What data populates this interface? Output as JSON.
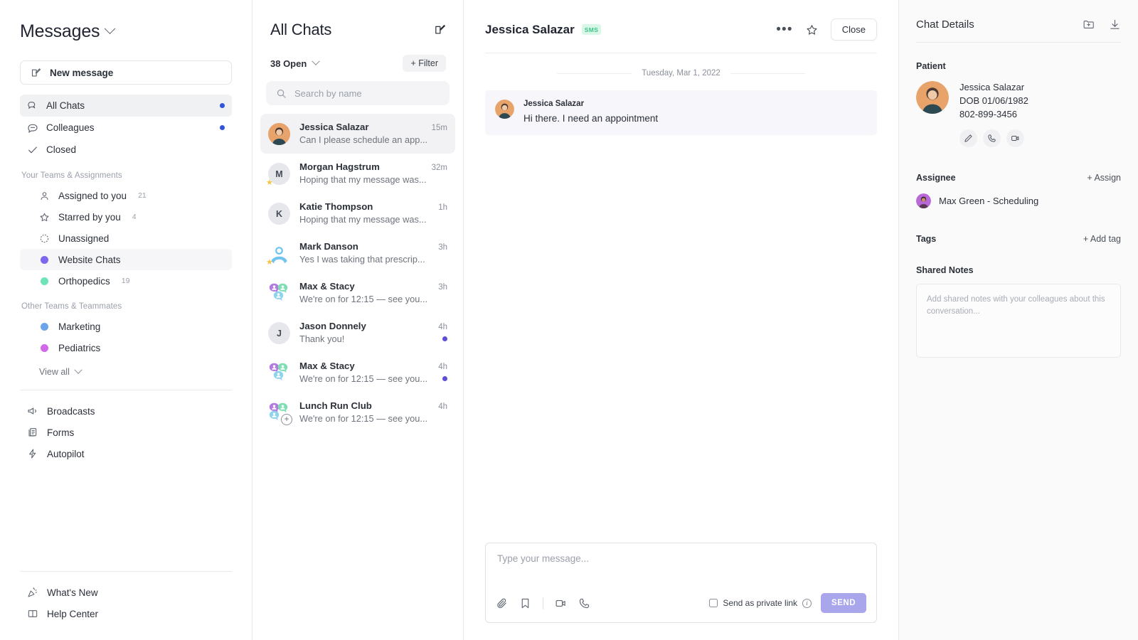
{
  "nav": {
    "title": "Messages",
    "new_message_label": "New message",
    "primary_items": [
      {
        "label": "All Chats",
        "icon": "chats-icon",
        "unread": true,
        "active": true
      },
      {
        "label": "Colleagues",
        "icon": "speech-bubble-icon",
        "unread": true,
        "active": false
      },
      {
        "label": "Closed",
        "icon": "check-icon",
        "unread": false,
        "active": false
      }
    ],
    "your_teams_label": "Your Teams & Assignments",
    "your_teams": [
      {
        "label": "Assigned to you",
        "count": "21",
        "icon": "person-icon",
        "color": ""
      },
      {
        "label": "Starred by you",
        "count": "4",
        "icon": "star-icon",
        "color": ""
      },
      {
        "label": "Unassigned",
        "count": "",
        "icon": "dashed-circle-icon",
        "color": ""
      },
      {
        "label": "Website Chats",
        "count": "",
        "icon": "color-dot",
        "color": "#7b68ee"
      },
      {
        "label": "Orthopedics",
        "count": "19",
        "icon": "color-dot",
        "color": "#6fe3b8"
      }
    ],
    "other_teams_label": "Other Teams & Teammates",
    "other_teams": [
      {
        "label": "Marketing",
        "count": "",
        "icon": "color-dot",
        "color": "#6ba4e8"
      },
      {
        "label": "Pediatrics",
        "count": "",
        "icon": "color-dot",
        "color": "#d369e8"
      }
    ],
    "view_all_label": "View all",
    "tools": [
      {
        "label": "Broadcasts",
        "icon": "megaphone-icon"
      },
      {
        "label": "Forms",
        "icon": "forms-icon"
      },
      {
        "label": "Autopilot",
        "icon": "bolt-icon"
      }
    ],
    "footer": [
      {
        "label": "What's New",
        "icon": "confetti-icon"
      },
      {
        "label": "Help Center",
        "icon": "book-icon"
      }
    ]
  },
  "list": {
    "title": "All Chats",
    "compose_icon": "compose-icon",
    "open_count_label": "38 Open",
    "filter_label": "+ Filter",
    "search_placeholder": "Search by name",
    "search_value": "",
    "chats": [
      {
        "name": "Jessica Salazar",
        "time": "15m",
        "preview": "Can I please schedule an app...",
        "avatar": "photo",
        "avatar_color": "#e8a36b",
        "initial": "",
        "starred": false,
        "unread": false,
        "active": true
      },
      {
        "name": "Morgan Hagstrum",
        "time": "32m",
        "preview": "Hoping that my message was...",
        "avatar": "initial",
        "avatar_color": "#e6e7ea",
        "initial": "M",
        "starred": true,
        "unread": false,
        "active": false
      },
      {
        "name": "Katie Thompson",
        "time": "1h",
        "preview": "Hoping that my message was...",
        "avatar": "initial",
        "avatar_color": "#e6e7ea",
        "initial": "K",
        "starred": false,
        "unread": false,
        "active": false
      },
      {
        "name": "Mark Danson",
        "time": "3h",
        "preview": "Yes I was taking that prescrip...",
        "avatar": "person",
        "avatar_color": "#6fc4f0",
        "initial": "",
        "starred": true,
        "unread": false,
        "active": false
      },
      {
        "name": "Max & Stacy",
        "time": "3h",
        "preview": "We're on for 12:15 — see you...",
        "avatar": "group",
        "avatar_color": "",
        "initial": "",
        "starred": false,
        "unread": false,
        "active": false
      },
      {
        "name": "Jason Donnely",
        "time": "4h",
        "preview": "Thank you!",
        "avatar": "initial",
        "avatar_color": "#e6e7ea",
        "initial": "J",
        "starred": false,
        "unread": true,
        "active": false
      },
      {
        "name": "Max & Stacy",
        "time": "4h",
        "preview": "We're on for 12:15 — see you...",
        "avatar": "group",
        "avatar_color": "",
        "initial": "",
        "starred": false,
        "unread": true,
        "active": false
      },
      {
        "name": "Lunch Run Club",
        "time": "4h",
        "preview": "We're on for 12:15 — see you...",
        "avatar": "group-plus",
        "avatar_color": "",
        "initial": "",
        "starred": false,
        "unread": false,
        "active": false
      }
    ]
  },
  "conversation": {
    "contact_name": "Jessica Salazar",
    "channel_badge": "SMS",
    "more_icon": "more-horizontal-icon",
    "star_icon": "star-icon",
    "close_label": "Close",
    "day_separator": "Tuesday, Mar 1, 2022",
    "messages": [
      {
        "sender": "Jessica Salazar",
        "text": "Hi there. I need an appointment"
      }
    ],
    "composer": {
      "placeholder": "Type your message...",
      "value": "",
      "tools": [
        "attachment-icon",
        "bookmark-icon",
        "video-icon",
        "phone-icon"
      ],
      "private_link_label": "Send as private link",
      "private_link_checked": false,
      "send_label": "SEND"
    }
  },
  "details": {
    "title": "Chat Details",
    "header_icons": [
      "patient-chart-icon",
      "download-icon"
    ],
    "patient_label": "Patient",
    "patient": {
      "name": "Jessica Salazar",
      "dob": "DOB 01/06/1982",
      "phone": "802-899-3456",
      "actions": [
        "edit-icon",
        "phone-icon",
        "video-icon"
      ]
    },
    "assignee_label": "Assignee",
    "assign_link": "+ Assign",
    "assignee_name": "Max Green - Scheduling",
    "tags_label": "Tags",
    "add_tag_link": "+ Add tag",
    "shared_notes_label": "Shared Notes",
    "shared_notes_placeholder": "Add shared notes with your colleagues about this conversation...",
    "shared_notes_value": ""
  },
  "colors": {
    "unread_blue": "#3253dc",
    "unread_purple": "#5d4fd6",
    "send_button": "#a9a6ec",
    "sms_badge_bg": "#d9f7e7",
    "sms_badge_text": "#3ec48a"
  }
}
